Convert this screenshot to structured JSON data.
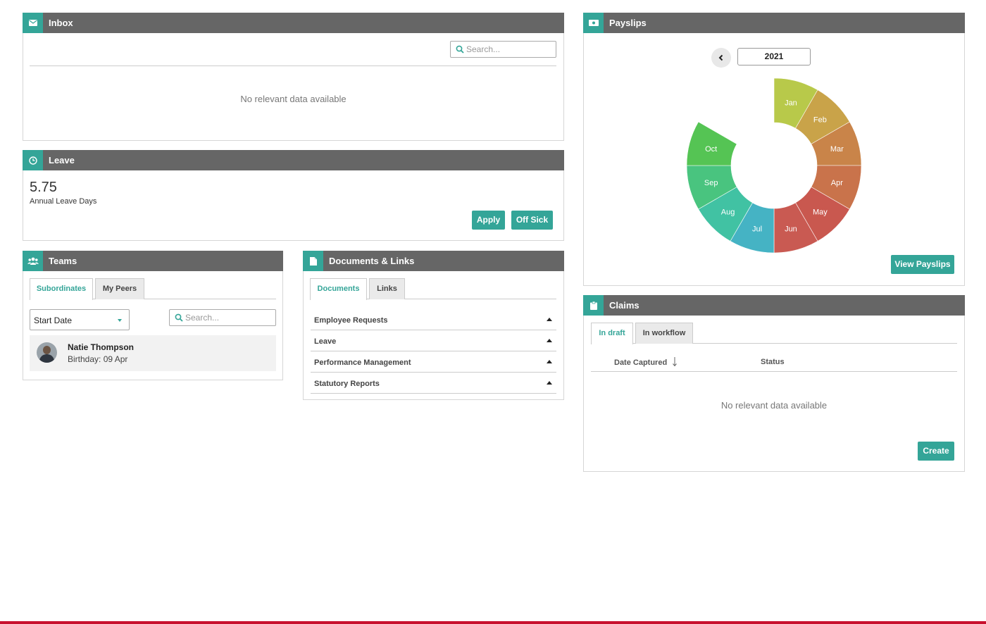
{
  "inbox": {
    "title": "Inbox",
    "search_placeholder": "Search...",
    "empty_text": "No relevant data available"
  },
  "leave": {
    "title": "Leave",
    "value": "5.75",
    "label": "Annual Leave Days",
    "apply_label": "Apply",
    "off_sick_label": "Off Sick"
  },
  "teams": {
    "title": "Teams",
    "tabs": [
      "Subordinates",
      "My Peers"
    ],
    "sort_select": "Start Date",
    "search_placeholder": "Search...",
    "members": [
      {
        "name": "Natie Thompson",
        "detail": "Birthday: 09 Apr"
      }
    ]
  },
  "documents": {
    "title": "Documents & Links",
    "tabs": [
      "Documents",
      "Links"
    ],
    "sections": [
      "Employee Requests",
      "Leave",
      "Performance Management",
      "Statutory Reports"
    ]
  },
  "payslips": {
    "title": "Payslips",
    "year": "2021",
    "months": [
      "Jan",
      "Feb",
      "Mar",
      "Apr",
      "May",
      "Jun",
      "Jul",
      "Aug",
      "Sep",
      "Oct"
    ],
    "month_colors": [
      "#b8c94a",
      "#c9a349",
      "#c98449",
      "#c9734b",
      "#c9584f",
      "#c95a52",
      "#45b3c4",
      "#41c2a3",
      "#49c47f",
      "#55c454"
    ],
    "view_label": "View Payslips"
  },
  "claims": {
    "title": "Claims",
    "tabs": [
      "In draft",
      "In workflow"
    ],
    "columns": [
      "Date Captured",
      "Status"
    ],
    "empty_text": "No relevant data available",
    "create_label": "Create"
  },
  "colors": {
    "accent": "#34a598",
    "header": "#666666",
    "footer_bar": "#c8102e"
  }
}
